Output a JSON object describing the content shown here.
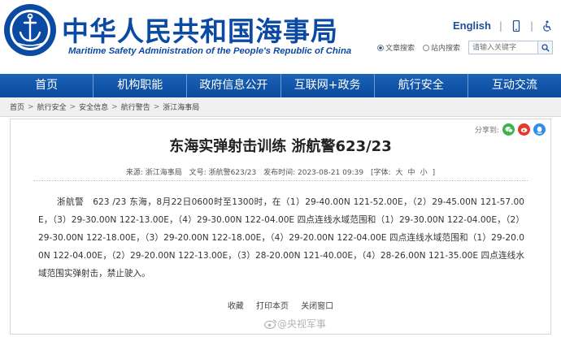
{
  "header": {
    "logo_text_top": "中华人民共和国海事局",
    "logo_text_bottom": "CHINA MSA",
    "title": "中华人民共和国海事局",
    "subtitle": "Maritime Safety Administration of the People's Republic of China",
    "english_link": "English",
    "search": {
      "option_title": "文章搜索",
      "option_all": "站内搜索",
      "placeholder": "请输入关键字"
    }
  },
  "nav": [
    "首页",
    "机构职能",
    "政府信息公开",
    "互联网+政务",
    "航行安全",
    "互动交流"
  ],
  "breadcrumb": [
    "首页",
    "航行安全",
    "安全信息",
    "航行警告",
    "浙江海事局"
  ],
  "article": {
    "share_label": "分享到:",
    "title": "东海实弹射击训练 浙航警623/23",
    "meta": {
      "source": "来源: 浙江海事局",
      "doc_no": "文号: 浙航警623/23",
      "date": "发布时间: 2023-08-21 09:39",
      "font_label": "[字体:",
      "font_large": "大",
      "font_medium": "中",
      "font_small": "小",
      "font_close": "]"
    },
    "body": "浙航警　623 /23 东海，8月22日0600时至1300时，在（1）29-40.00N 121-52.00E，（2）29-45.00N 121-57.00E，（3）29-30.00N 122-13.00E，（4）29-30.00N 122-04.00E 四点连线水域范围和（1）29-30.00N 122-04.00E，（2）29-30.00N 122-18.00E，（3）29-20.00N 122-18.00E，（4）29-20.00N 122-04.00E 四点连线水域范围和（1）29-20.00N 122-04.00E，（2）29-20.00N 122-13.00E，（3）28-20.00N 121-40.00E，（4）28-26.00N 121-35.00E 四点连线水域范围实弹射击，禁止驶入。",
    "actions": [
      "收藏",
      "打印本页",
      "关闭窗口"
    ]
  },
  "watermark": "@央视军事",
  "colors": {
    "brand_blue": "#0b4aa3",
    "nav_blue": "#1457ab"
  }
}
